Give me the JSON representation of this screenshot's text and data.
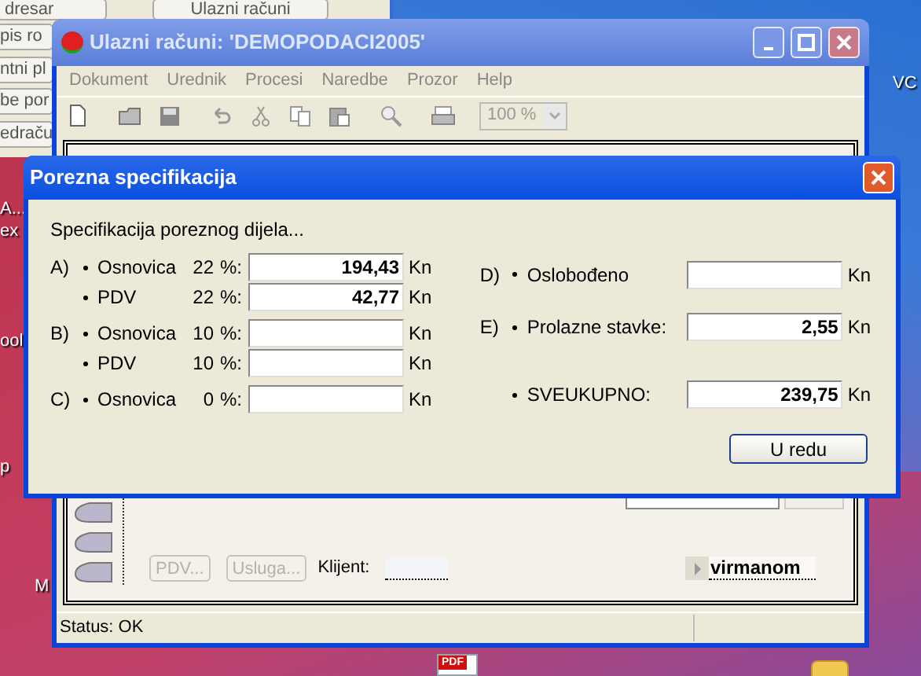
{
  "desktop": {
    "right_labels": [
      "VC"
    ],
    "left_labels": [
      "A...",
      "ex",
      "ool",
      "p",
      "M"
    ],
    "files": [
      {
        "kind": "pdf",
        "label": "PDF"
      },
      {
        "kind": "folder"
      }
    ]
  },
  "background_window": {
    "buttons": [
      "dresar",
      "Ulazni računi"
    ],
    "rows": [
      "pis ro",
      "ntni pl",
      "be por",
      "edraču"
    ]
  },
  "main_window": {
    "title": "Ulazni računi: 'DEMOPODACI2005'",
    "menu": [
      "Dokument",
      "Urednik",
      "Procesi",
      "Naredbe",
      "Prozor",
      "Help"
    ],
    "zoom": "100 %",
    "buttons": [
      {
        "label": "PDV...",
        "disabled": true
      },
      {
        "label": "Usluga...",
        "disabled": true
      }
    ],
    "client_label": "Klijent:",
    "payment": "virmanom",
    "status": "Status: OK"
  },
  "dialog": {
    "title": "Porezna specifikacija",
    "heading": "Specifikacija poreznog dijela...",
    "left_rows": [
      {
        "section": "A)",
        "label": "Osnovica",
        "rate": "22",
        "unit": "%:",
        "value": "194,43",
        "currency": "Kn"
      },
      {
        "label": "PDV",
        "rate": "22",
        "unit": "%:",
        "value": "42,77",
        "currency": "Kn"
      },
      {
        "section": "B)",
        "label": "Osnovica",
        "rate": "10",
        "unit": "%:",
        "currency": "Kn"
      },
      {
        "label": "PDV",
        "rate": "10",
        "unit": "%:",
        "currency": "Kn"
      },
      {
        "section": "C)",
        "label": "Osnovica",
        "rate": "0",
        "unit": "%:",
        "currency": "Kn"
      }
    ],
    "right_rows": [
      {
        "section": "D)",
        "label": "Oslobođeno",
        "currency": "Kn"
      },
      {
        "section": "E)",
        "label": "Prolazne stavke:",
        "value": "2,55",
        "currency": "Kn"
      },
      {
        "label": "SVEUKUPNO:",
        "value": "239,75",
        "currency": "Kn"
      }
    ],
    "ok_button": "U redu"
  }
}
